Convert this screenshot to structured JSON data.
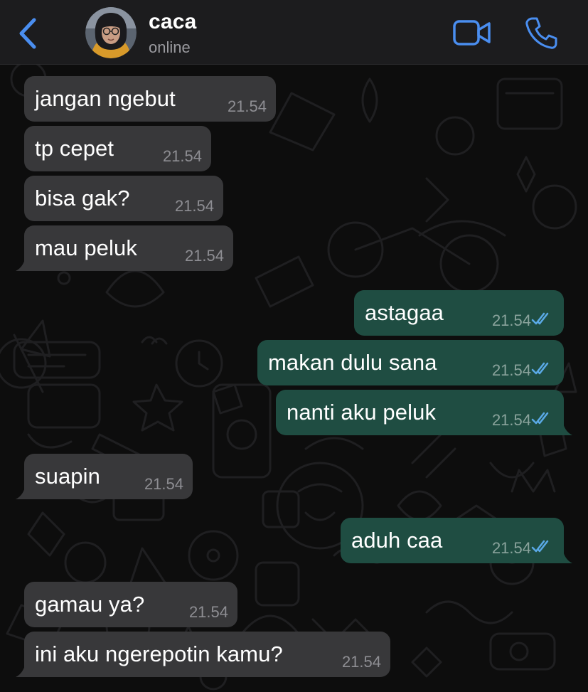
{
  "header": {
    "contact_name": "caca",
    "status": "online",
    "back_icon": "chevron-left-icon",
    "video_icon": "video-camera-icon",
    "call_icon": "phone-icon"
  },
  "colors": {
    "accent": "#4a8ef0",
    "incoming_bubble": "#38383a",
    "outgoing_bubble": "#1f4d42",
    "header_bg": "#1c1c1e",
    "read_ticks": "#5aa9e6"
  },
  "messages": [
    {
      "direction": "in",
      "text": "jangan ngebut",
      "time": "21.54"
    },
    {
      "direction": "in",
      "text": "tp cepet",
      "time": "21.54"
    },
    {
      "direction": "in",
      "text": "bisa gak?",
      "time": "21.54"
    },
    {
      "direction": "in",
      "text": "mau peluk",
      "time": "21.54"
    },
    {
      "direction": "out",
      "text": "astagaa",
      "time": "21.54",
      "read": true
    },
    {
      "direction": "out",
      "text": "makan dulu sana",
      "time": "21.54",
      "read": true
    },
    {
      "direction": "out",
      "text": "nanti aku peluk",
      "time": "21.54",
      "read": true
    },
    {
      "direction": "in",
      "text": "suapin",
      "time": "21.54"
    },
    {
      "direction": "out",
      "text": "aduh caa",
      "time": "21.54",
      "read": true
    },
    {
      "direction": "in",
      "text": "gamau ya?",
      "time": "21.54"
    },
    {
      "direction": "in",
      "text": "ini aku ngerepotin kamu?",
      "time": "21.54"
    }
  ]
}
